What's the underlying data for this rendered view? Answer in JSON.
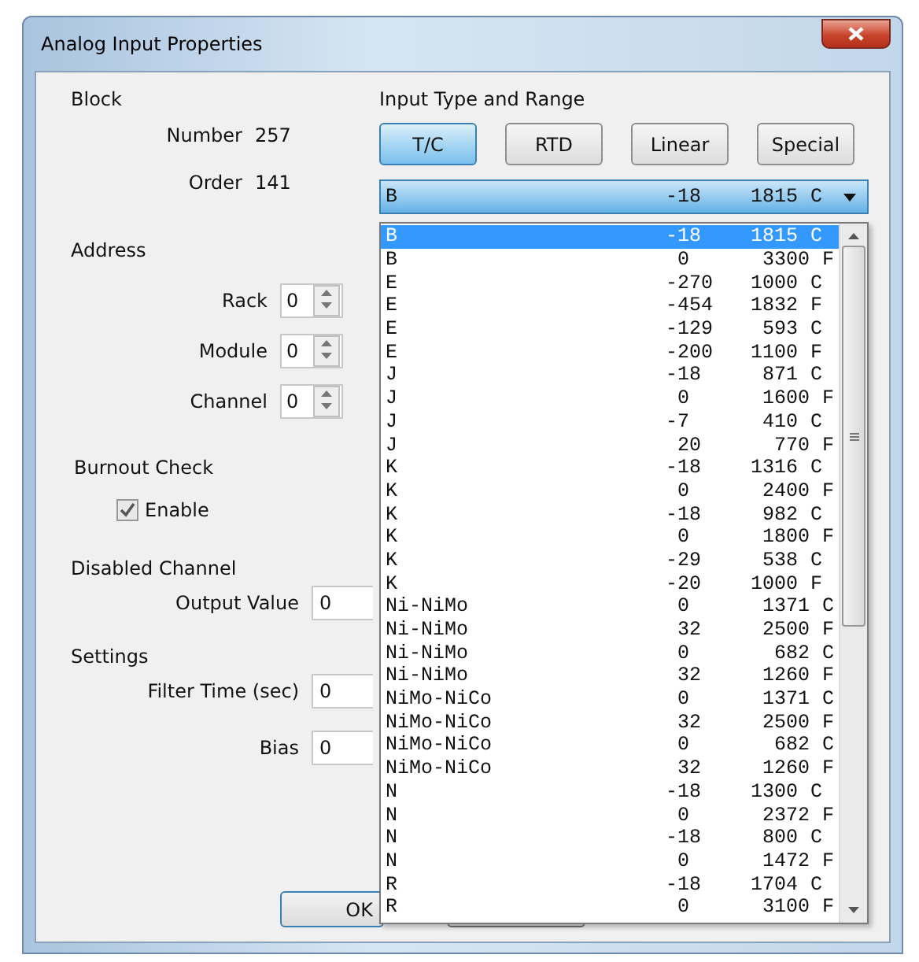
{
  "window": {
    "title": "Analog Input Properties"
  },
  "block": {
    "heading": "Block",
    "fields": [
      {
        "label": "Number",
        "value": "257"
      },
      {
        "label": "Order",
        "value": "141"
      }
    ]
  },
  "address": {
    "heading": "Address",
    "spinners": [
      {
        "label": "Rack",
        "value": "0"
      },
      {
        "label": "Module",
        "value": "0"
      },
      {
        "label": "Channel",
        "value": "0"
      }
    ]
  },
  "burnout_check": {
    "heading": "Burnout Check",
    "checkbox": {
      "label": "Enable",
      "checked": true
    }
  },
  "disabled_channel": {
    "heading": "Disabled Channel",
    "fields": [
      {
        "label": "Output Value",
        "value": "0"
      }
    ]
  },
  "settings": {
    "heading": "Settings",
    "fields": [
      {
        "label": "Filter Time (sec)",
        "value": "0"
      },
      {
        "label": "Bias",
        "value": "0"
      }
    ]
  },
  "input_type": {
    "heading": "Input Type and Range",
    "buttons": [
      {
        "label": "T/C",
        "selected": true
      },
      {
        "label": "RTD",
        "selected": false
      },
      {
        "label": "Linear",
        "selected": false
      },
      {
        "label": "Special",
        "selected": false
      }
    ],
    "combo": {
      "name": "B",
      "min": "-18",
      "max": "1815",
      "unit": "C"
    },
    "rows": [
      {
        "name": "B",
        "min": "-18",
        "max": "1815",
        "unit": "C",
        "selected": true
      },
      {
        "name": "B",
        "min": "0",
        "max": "3300",
        "unit": "F",
        "selected": false
      },
      {
        "name": "E",
        "min": "-270",
        "max": "1000",
        "unit": "C",
        "selected": false
      },
      {
        "name": "E",
        "min": "-454",
        "max": "1832",
        "unit": "F",
        "selected": false
      },
      {
        "name": "E",
        "min": "-129",
        "max": "593",
        "unit": "C",
        "selected": false
      },
      {
        "name": "E",
        "min": "-200",
        "max": "1100",
        "unit": "F",
        "selected": false
      },
      {
        "name": "J",
        "min": "-18",
        "max": "871",
        "unit": "C",
        "selected": false
      },
      {
        "name": "J",
        "min": "0",
        "max": "1600",
        "unit": "F",
        "selected": false
      },
      {
        "name": "J",
        "min": "-7",
        "max": "410",
        "unit": "C",
        "selected": false
      },
      {
        "name": "J",
        "min": "20",
        "max": "770",
        "unit": "F",
        "selected": false
      },
      {
        "name": "K",
        "min": "-18",
        "max": "1316",
        "unit": "C",
        "selected": false
      },
      {
        "name": "K",
        "min": "0",
        "max": "2400",
        "unit": "F",
        "selected": false
      },
      {
        "name": "K",
        "min": "-18",
        "max": "982",
        "unit": "C",
        "selected": false
      },
      {
        "name": "K",
        "min": "0",
        "max": "1800",
        "unit": "F",
        "selected": false
      },
      {
        "name": "K",
        "min": "-29",
        "max": "538",
        "unit": "C",
        "selected": false
      },
      {
        "name": "K",
        "min": "-20",
        "max": "1000",
        "unit": "F",
        "selected": false
      },
      {
        "name": "Ni-NiMo",
        "min": "0",
        "max": "1371",
        "unit": "C",
        "selected": false
      },
      {
        "name": "Ni-NiMo",
        "min": "32",
        "max": "2500",
        "unit": "F",
        "selected": false
      },
      {
        "name": "Ni-NiMo",
        "min": "0",
        "max": "682",
        "unit": "C",
        "selected": false
      },
      {
        "name": "Ni-NiMo",
        "min": "32",
        "max": "1260",
        "unit": "F",
        "selected": false
      },
      {
        "name": "NiMo-NiCo",
        "min": "0",
        "max": "1371",
        "unit": "C",
        "selected": false
      },
      {
        "name": "NiMo-NiCo",
        "min": "32",
        "max": "2500",
        "unit": "F",
        "selected": false
      },
      {
        "name": "NiMo-NiCo",
        "min": "0",
        "max": "682",
        "unit": "C",
        "selected": false
      },
      {
        "name": "NiMo-NiCo",
        "min": "32",
        "max": "1260",
        "unit": "F",
        "selected": false
      },
      {
        "name": "N",
        "min": "-18",
        "max": "1300",
        "unit": "C",
        "selected": false
      },
      {
        "name": "N",
        "min": "0",
        "max": "2372",
        "unit": "F",
        "selected": false
      },
      {
        "name": "N",
        "min": "-18",
        "max": "800",
        "unit": "C",
        "selected": false
      },
      {
        "name": "N",
        "min": "0",
        "max": "1472",
        "unit": "F",
        "selected": false
      },
      {
        "name": "R",
        "min": "-18",
        "max": "1704",
        "unit": "C",
        "selected": false
      },
      {
        "name": "R",
        "min": "0",
        "max": "3100",
        "unit": "F",
        "selected": false
      }
    ]
  },
  "buttons": [
    {
      "label": "OK",
      "kind": "default"
    },
    {
      "kind": "hidden"
    }
  ]
}
